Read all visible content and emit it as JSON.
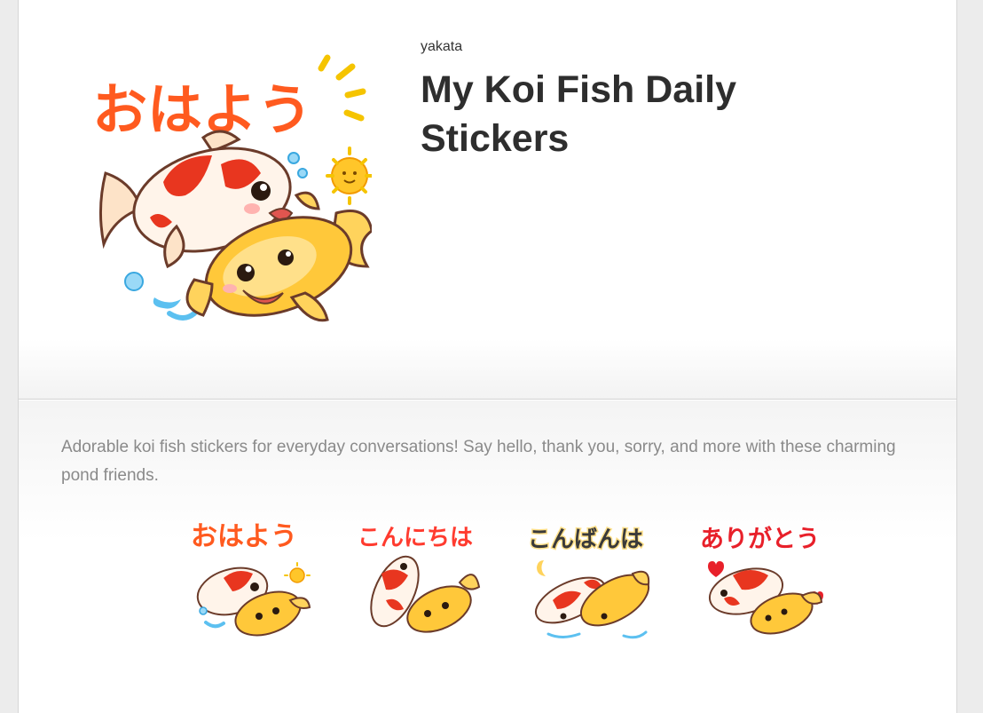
{
  "header": {
    "author": "yakata",
    "title": "My Koi Fish Daily Stickers"
  },
  "main_sticker": {
    "text": "おはよう",
    "icon": "koi-sticker-icon"
  },
  "description": "Adorable koi fish stickers for everyday conversations! Say hello, thank you, sorry, and more with these charming pond friends.",
  "stickers": [
    {
      "text": "おはよう",
      "colors": [
        "#ff5a1f",
        "#ff9a00"
      ],
      "accent": "sun"
    },
    {
      "text": "こんにちは",
      "colors": [
        "#ff3b2f",
        "#ffb400"
      ],
      "accent": "none"
    },
    {
      "text": "こんばんは",
      "colors": [
        "#3a3a3a",
        "#ffb000"
      ],
      "accent": "moon"
    },
    {
      "text": "ありがとう",
      "colors": [
        "#e8202a",
        "#ffa000"
      ],
      "accent": "heart"
    }
  ],
  "colors": {
    "koi_red": "#e8361f",
    "koi_gold": "#f7b52a",
    "water": "#5cc0f0"
  }
}
